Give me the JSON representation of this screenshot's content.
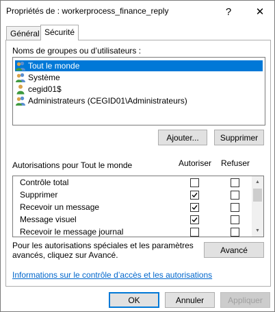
{
  "window": {
    "title": "Propriétés de : workerprocess_finance_reply",
    "help_glyph": "?",
    "close_glyph": "✕"
  },
  "tabs": [
    {
      "label": "Général",
      "active": false
    },
    {
      "label": "Sécurité",
      "active": true
    }
  ],
  "security": {
    "groups_label": "Noms de groupes ou d’utilisateurs :",
    "users": [
      {
        "name": "Tout le monde",
        "icon": "user-group-icon",
        "selected": true
      },
      {
        "name": "Système",
        "icon": "user-group-icon",
        "selected": false
      },
      {
        "name": "cegid01$",
        "icon": "user-icon",
        "selected": false
      },
      {
        "name": "Administrateurs (CEGID01\\Administrateurs)",
        "icon": "user-group-icon",
        "selected": false
      }
    ],
    "add_button": "Ajouter...",
    "remove_button": "Supprimer",
    "permissions_label": "Autorisations pour Tout le monde",
    "allow_header": "Autoriser",
    "deny_header": "Refuser",
    "permissions": [
      {
        "name": "Contrôle total",
        "allow": false,
        "deny": false
      },
      {
        "name": "Supprimer",
        "allow": true,
        "deny": false
      },
      {
        "name": "Recevoir un message",
        "allow": true,
        "deny": false
      },
      {
        "name": "Message visuel",
        "allow": true,
        "deny": false
      },
      {
        "name": "Recevoir le message journal",
        "allow": false,
        "deny": false
      }
    ],
    "advanced_text_line1": "Pour les autorisations spéciales et les paramètres",
    "advanced_text_line2": "avancés, cliquez sur Avancé.",
    "advanced_button": "Avancé",
    "info_link": "Informations sur le contrôle d’accès et les autorisations"
  },
  "footer": {
    "ok": "OK",
    "cancel": "Annuler",
    "apply": "Appliquer"
  }
}
